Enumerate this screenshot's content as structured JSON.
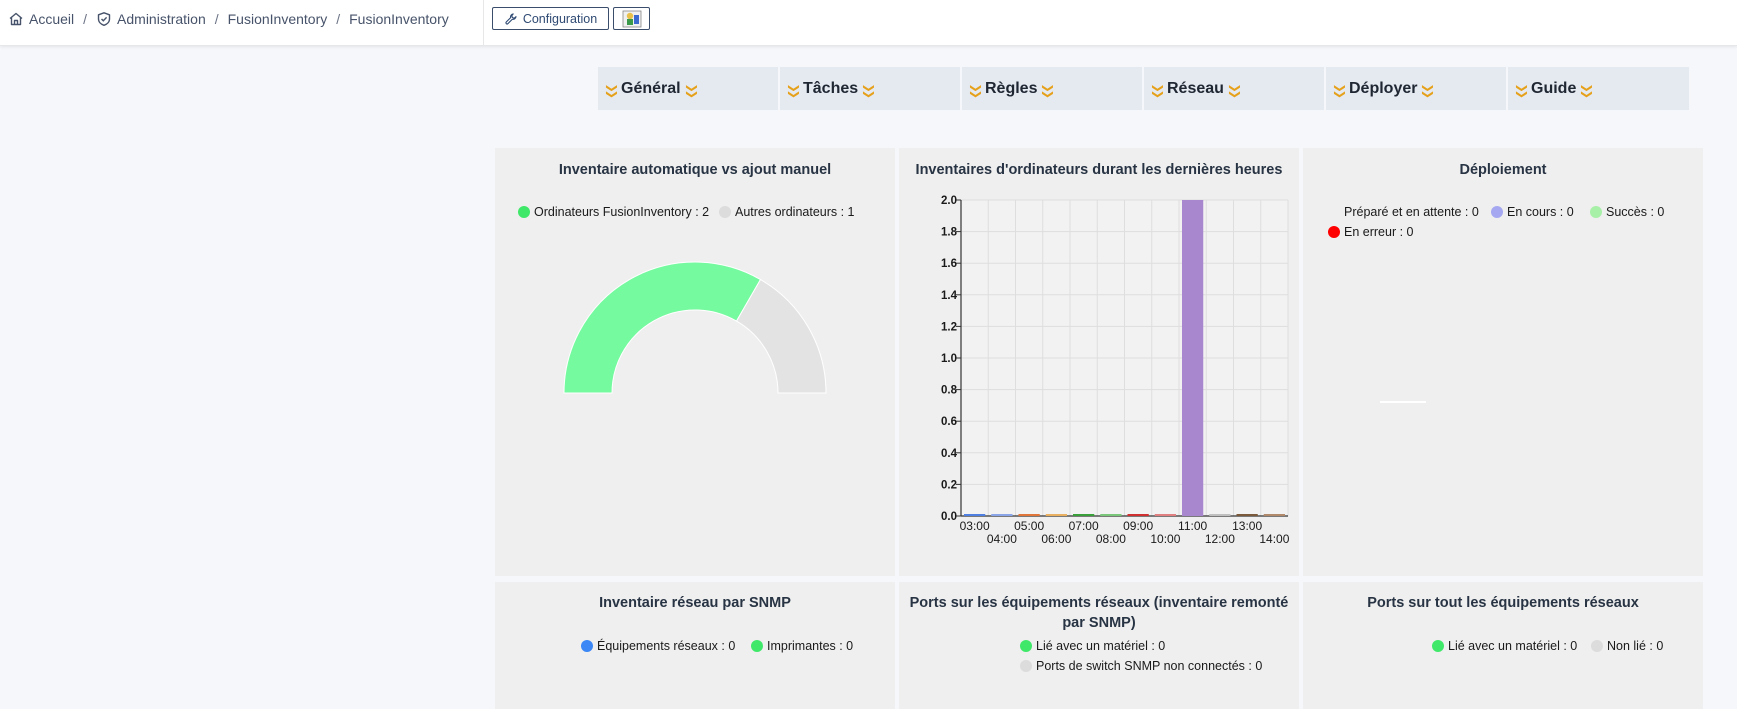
{
  "breadcrumb": {
    "items": [
      {
        "label": "Accueil",
        "icon": "home-icon"
      },
      {
        "label": "Administration",
        "icon": "shield-icon"
      },
      {
        "label": "FusionInventory"
      },
      {
        "label": "FusionInventory"
      }
    ],
    "separator": "/"
  },
  "toolbar": {
    "config_label": "Configuration",
    "config_icon": "wrench-icon",
    "plugin_icon": "fusioninventory-logo-icon"
  },
  "menu": {
    "tabs": [
      "Général",
      "Tâches",
      "Règles",
      "Réseau",
      "Déployer",
      "Guide"
    ],
    "chevron_color": "#e6a11b"
  },
  "panels": {
    "auto_vs_manual": {
      "title": "Inventaire automatique vs ajout manuel",
      "legend": [
        {
          "label": "Ordinateurs FusionInventory : 2",
          "color": "#40e86a"
        },
        {
          "label": "Autres ordinateurs : 1",
          "color": "#dcdcdc"
        }
      ]
    },
    "recent_inventories": {
      "title": "Inventaires d'ordinateurs durant les dernières heures"
    },
    "deploy": {
      "title": "Déploiement",
      "legend": [
        {
          "label": "Préparé et en attente : 0",
          "color": "#efefef"
        },
        {
          "label": "En cours : 0",
          "color": "#a5a8f0"
        },
        {
          "label": "Succès : 0",
          "color": "#a6f0a8"
        },
        {
          "label": "En erreur : 0",
          "color": "#ff0000"
        }
      ]
    },
    "snmp_inventory": {
      "title": "Inventaire réseau par SNMP",
      "legend": [
        {
          "label": "Équipements réseaux : 0",
          "color": "#3a87f5"
        },
        {
          "label": "Imprimantes : 0",
          "color": "#40e86a"
        }
      ]
    },
    "snmp_ports": {
      "title_line1": "Ports sur les équipements réseaux (inventaire remonté",
      "title_line2": "par SNMP)",
      "legend": [
        {
          "label": "Lié avec un matériel : 0",
          "color": "#40e86a"
        },
        {
          "label": "Ports de switch SNMP non connectés : 0",
          "color": "#dcdcdc"
        }
      ]
    },
    "all_ports": {
      "title": "Ports sur tout les équipements réseaux",
      "legend": [
        {
          "label": "Lié avec un matériel : 0",
          "color": "#40e86a"
        },
        {
          "label": "Non lié : 0",
          "color": "#dcdcdc"
        }
      ]
    }
  },
  "chart_data": [
    {
      "type": "pie",
      "title": "Inventaire automatique vs ajout manuel",
      "style": "half-donut",
      "series": [
        {
          "name": "Ordinateurs FusionInventory",
          "value": 2,
          "color": "#75fa9f"
        },
        {
          "name": "Autres ordinateurs",
          "value": 1,
          "color": "#e3e3e3"
        }
      ]
    },
    {
      "type": "bar",
      "title": "Inventaires d'ordinateurs durant les dernières heures",
      "categories": [
        "03:00",
        "04:00",
        "05:00",
        "06:00",
        "07:00",
        "08:00",
        "09:00",
        "10:00",
        "11:00",
        "12:00",
        "13:00",
        "14:00"
      ],
      "values": [
        0,
        0,
        0,
        0,
        0,
        0,
        0,
        0,
        2,
        0,
        0,
        0
      ],
      "colors": [
        "#4f7fe0",
        "#8aa6e8",
        "#e0763a",
        "#e8b060",
        "#3aa03a",
        "#7ac77a",
        "#d03030",
        "#e08080",
        "#a987cf",
        "#c0c0c0",
        "#7a5a3a",
        "#b08a6a"
      ],
      "ylim": [
        0,
        2
      ],
      "yticks": [
        "0.0",
        "0.2",
        "0.4",
        "0.6",
        "0.8",
        "1.0",
        "1.2",
        "1.4",
        "1.6",
        "1.8",
        "2.0"
      ],
      "grid": true
    }
  ]
}
